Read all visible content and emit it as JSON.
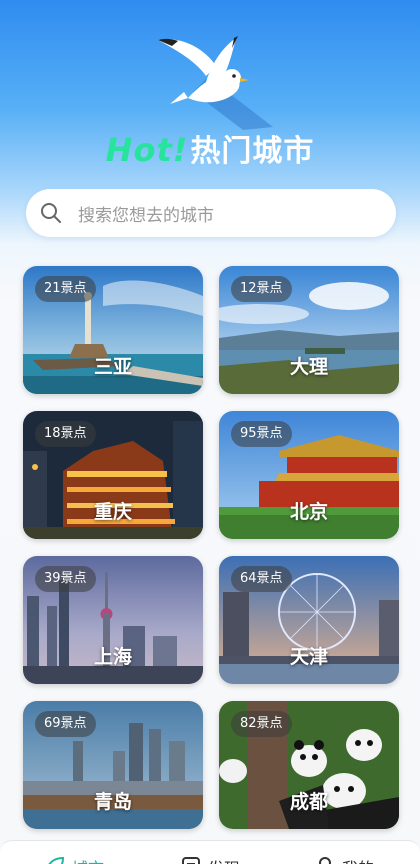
{
  "header": {
    "hot_label": "Hot!",
    "title": "热门城市",
    "mascot_icon": "seagull-logo"
  },
  "search": {
    "placeholder": "搜索您想去的城市",
    "icon": "search-icon"
  },
  "cities": [
    {
      "name": "三亚",
      "spots": "21景点"
    },
    {
      "name": "大理",
      "spots": "12景点"
    },
    {
      "name": "重庆",
      "spots": "18景点"
    },
    {
      "name": "北京",
      "spots": "95景点"
    },
    {
      "name": "上海",
      "spots": "39景点"
    },
    {
      "name": "天津",
      "spots": "64景点"
    },
    {
      "name": "青岛",
      "spots": "69景点"
    },
    {
      "name": "成都",
      "spots": "82景点"
    }
  ],
  "tabbar": {
    "tabs": [
      {
        "label": "城市",
        "icon": "leaf-icon",
        "active": true
      },
      {
        "label": "发现",
        "icon": "list-icon",
        "active": false
      },
      {
        "label": "我的",
        "icon": "person-icon",
        "active": false
      }
    ]
  },
  "colors": {
    "accent": "#1fb5a5",
    "hot_green": "#27e39b",
    "sky_blue": "#2f8cf0"
  }
}
